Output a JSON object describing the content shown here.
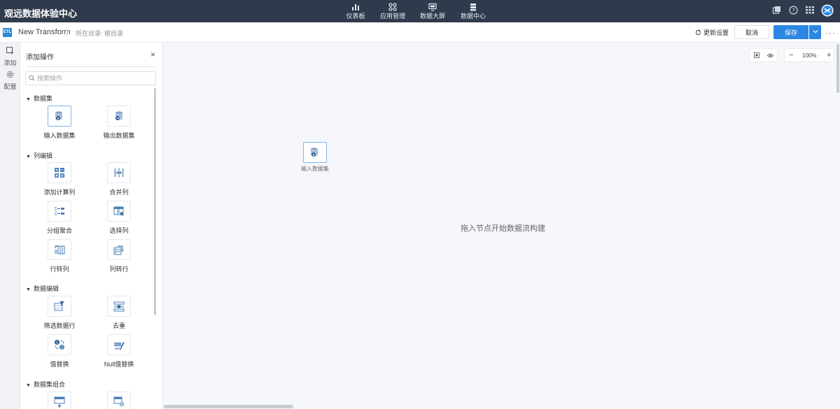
{
  "topnav": {
    "brand": "观远数据体验中心",
    "items": [
      {
        "label": "仪表板",
        "icon": "bar-chart-icon"
      },
      {
        "label": "应用管理",
        "icon": "apps-icon"
      },
      {
        "label": "数据大屏",
        "icon": "screen-icon"
      },
      {
        "label": "数据中心",
        "icon": "database-icon"
      }
    ]
  },
  "subbar": {
    "badge": "ETL",
    "title": "New Transform",
    "location": "所在目录: 根目录",
    "refresh_label": "更新设置",
    "cancel_label": "取消",
    "save_label": "保存",
    "more": "···"
  },
  "rail": {
    "add_label": "添加",
    "config_label": "配置"
  },
  "panel": {
    "title": "添加操作",
    "close": "×",
    "search_placeholder": "搜索操作",
    "sections": [
      {
        "title": "数据集",
        "items": [
          "输入数据集",
          "输出数据集"
        ]
      },
      {
        "title": "列编辑",
        "items": [
          "添加计算列",
          "合并列",
          "分组聚合",
          "选择列",
          "行转列",
          "列转行"
        ]
      },
      {
        "title": "数据编辑",
        "items": [
          "筛选数据行",
          "去重",
          "值替换",
          "Null值替换"
        ]
      },
      {
        "title": "数据集组合",
        "items": []
      }
    ]
  },
  "canvas": {
    "node_label": "输入数据集",
    "hint": "拖入节点开始数据流构建",
    "zoom_minus": "−",
    "zoom_value": "100%",
    "zoom_plus": "+"
  },
  "colors": {
    "nav_bg": "#2f3a4c",
    "accent": "#2b87e3",
    "icon_blue": "#4a7fb8"
  }
}
